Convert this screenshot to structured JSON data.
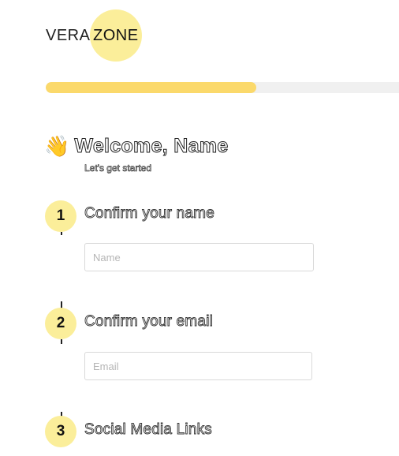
{
  "logo": {
    "left_text": "VERA",
    "right_text": "ZONE"
  },
  "progress": {
    "value_percent": 58
  },
  "header": {
    "wave_emoji": "👋",
    "title": "Welcome, Name",
    "subtitle": "Let's get started"
  },
  "steps": [
    {
      "number": "1",
      "title": "Confirm your name",
      "placeholder": "Name"
    },
    {
      "number": "2",
      "title": "Confirm your email",
      "placeholder": "Email"
    },
    {
      "number": "3",
      "title": "Social Media Links"
    }
  ],
  "colors": {
    "accent_yellow": "#fbd96b",
    "badge_yellow": "#fbee9a",
    "track_gray": "#f0f0f0"
  }
}
